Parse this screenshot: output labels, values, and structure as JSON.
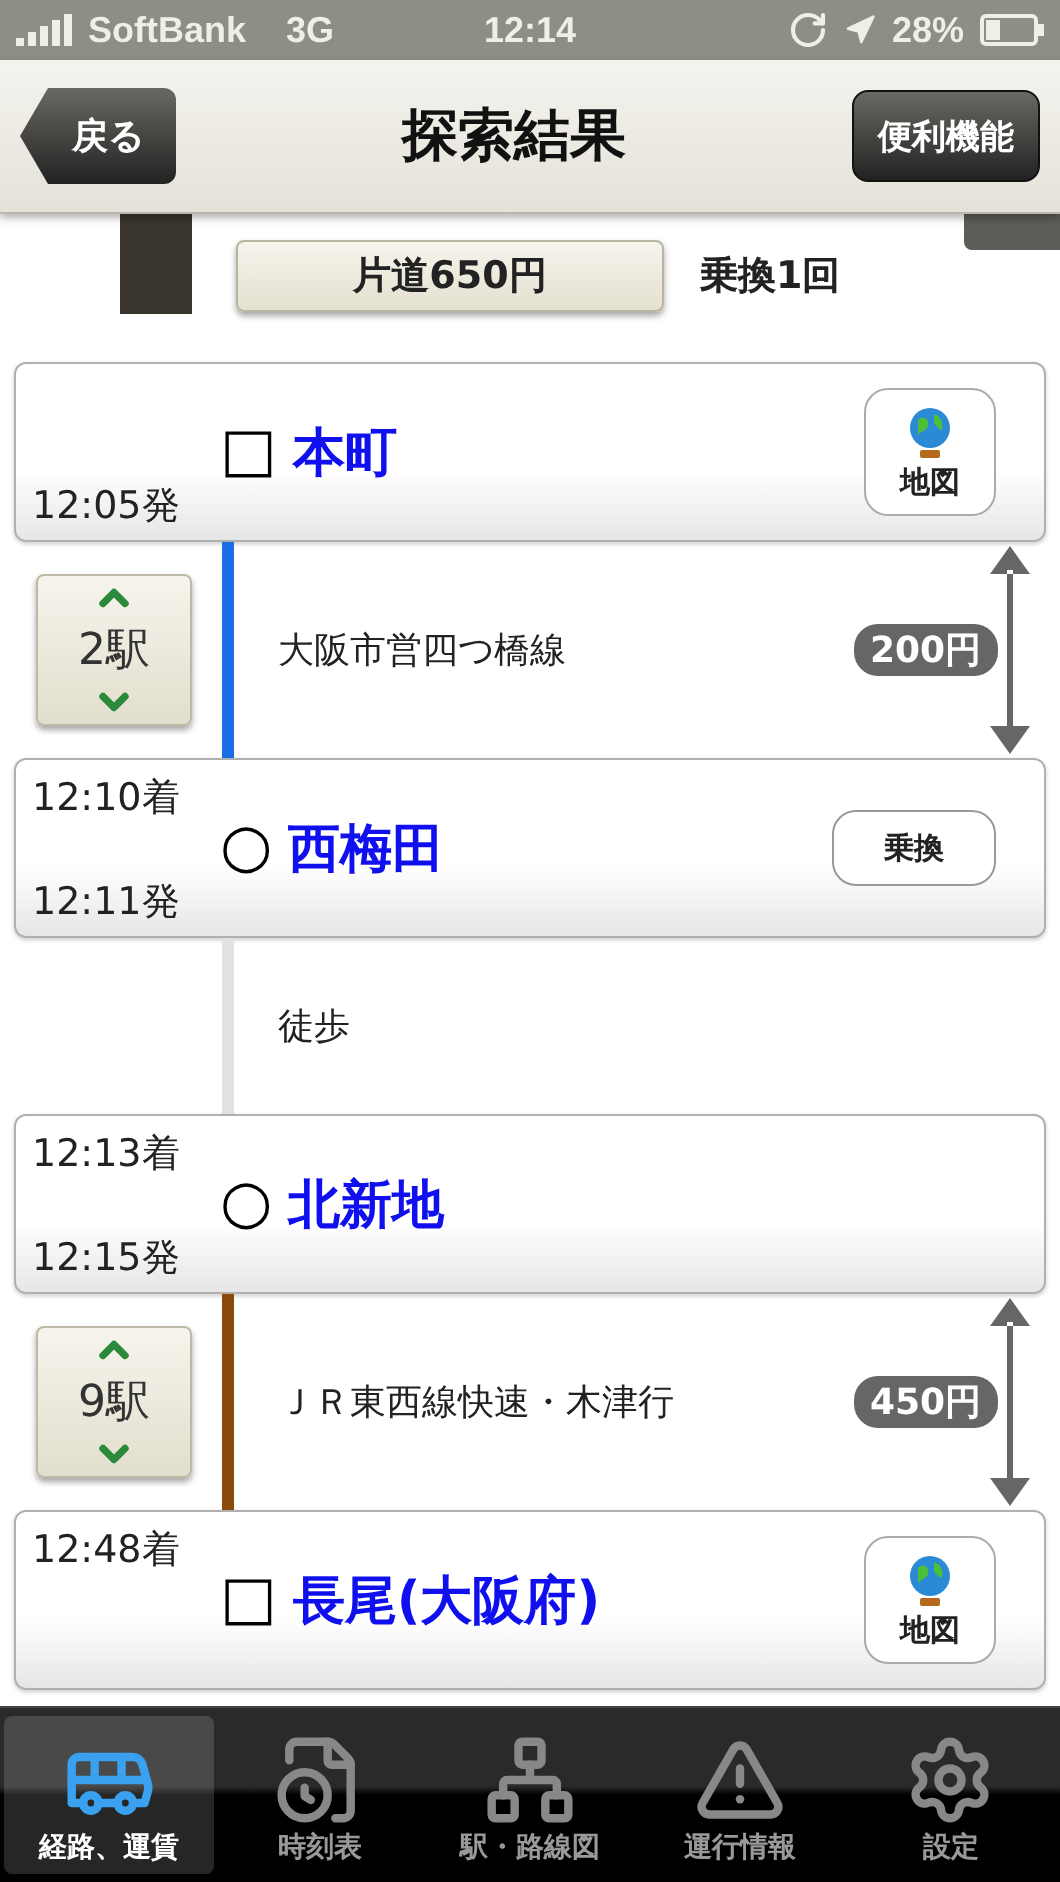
{
  "status_bar": {
    "carrier": "SoftBank",
    "network": "3G",
    "time": "12:14",
    "battery": "28%"
  },
  "nav": {
    "back": "戻る",
    "title": "探索結果",
    "action": "便利機能"
  },
  "summary": {
    "fare": "片道650円",
    "transfers": "乗換1回"
  },
  "route": [
    {
      "kind": "station",
      "marker": "□",
      "name": "本町",
      "departure": "12:05発",
      "button": {
        "kind": "map",
        "label": "地図"
      }
    },
    {
      "kind": "ride",
      "stops": "2駅",
      "line": "大阪市営四つ橋線",
      "color": "#1a6fe6",
      "fare": "200円"
    },
    {
      "kind": "station",
      "marker": "○",
      "name": "西梅田",
      "arrival": "12:10着",
      "departure": "12:11発",
      "button": {
        "kind": "transfer",
        "label": "乗換"
      }
    },
    {
      "kind": "walk",
      "line": "徒歩",
      "color": "#e2e2e2"
    },
    {
      "kind": "station",
      "marker": "○",
      "name": "北新地",
      "arrival": "12:13着",
      "departure": "12:15発"
    },
    {
      "kind": "ride",
      "stops": "9駅",
      "line": "ＪＲ東西線快速・木津行",
      "color": "#8a4a0c",
      "fare": "450円"
    },
    {
      "kind": "station",
      "marker": "□",
      "name": "長尾(大阪府)",
      "arrival": "12:48着",
      "button": {
        "kind": "map",
        "label": "地図"
      }
    }
  ],
  "tabs": [
    {
      "label": "経路、運賃",
      "selected": true
    },
    {
      "label": "時刻表",
      "selected": false
    },
    {
      "label": "駅・路線図",
      "selected": false
    },
    {
      "label": "運行情報",
      "selected": false
    },
    {
      "label": "設定",
      "selected": false
    }
  ]
}
